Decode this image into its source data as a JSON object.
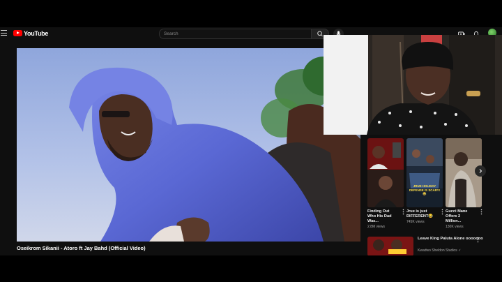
{
  "header": {
    "logo_text": "YouTube",
    "search_placeholder": "Search",
    "icons": [
      "menu-icon",
      "search-icon",
      "mic-icon",
      "create-icon",
      "notifications-icon",
      "avatar"
    ]
  },
  "video": {
    "title": "Oseikrom Sikanii - Atoro ft Jay Bahd (Official Video)"
  },
  "shorts": [
    {
      "title": "Finding Out Who His Dad Was...",
      "views": "2.8M views"
    },
    {
      "title": "Jrue is just DIFFERENT😂",
      "views": "745K views",
      "thumb_caption": "JRUE HOLIDAY DEFENSE IS SCARY!😂"
    },
    {
      "title": "Gucci Mane Offers 2 Million...",
      "views": "130K views"
    }
  ],
  "up_next": {
    "title": "Leave King Paluta Alone ooooooo",
    "channel": "Kwadwo Sheldon Studios ✓"
  },
  "colors": {
    "accent": "#ff0000",
    "background": "#0f0f0f",
    "text": "#f1f1f1",
    "secondary_text": "#aaaaaa",
    "hoodie": "#5a68d4"
  }
}
